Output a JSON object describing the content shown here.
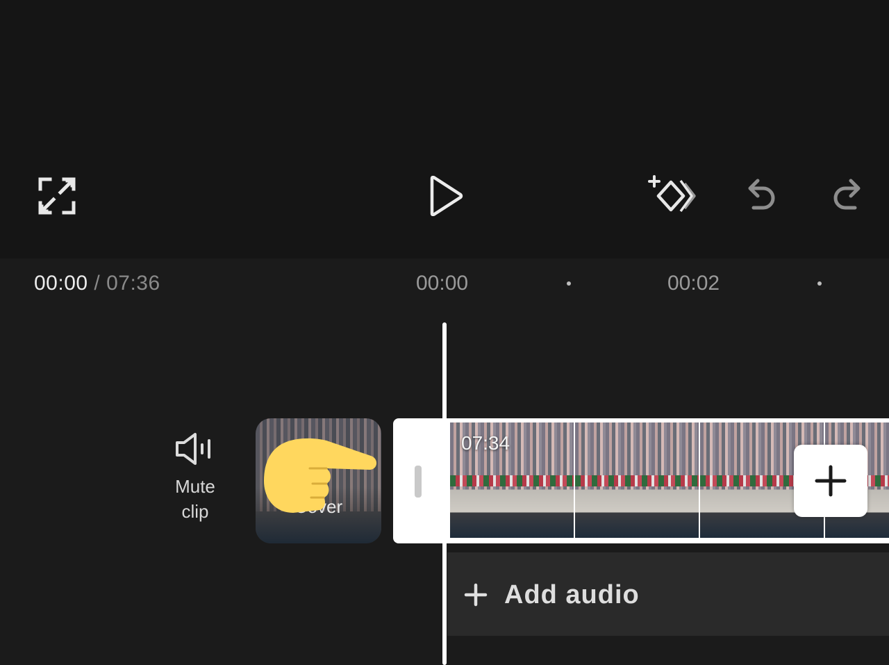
{
  "toolbar": {
    "fullscreen_icon": "fullscreen-icon",
    "play_icon": "play-icon",
    "keyframe_icon": "keyframe-icon",
    "undo_icon": "undo-icon",
    "redo_icon": "redo-icon"
  },
  "timeline": {
    "current_time": "00:00",
    "separator": " / ",
    "total_duration": "07:36",
    "ruler_labels": [
      "00:00",
      "00:02"
    ]
  },
  "track": {
    "mute_label_line1": "Mute",
    "mute_label_line2": "clip",
    "cover_label": "Cover",
    "clip_duration": "07:34",
    "add_clip_icon": "plus-icon",
    "add_audio_label": "Add audio"
  },
  "colors": {
    "background": "#181818",
    "preview_background": "#151515",
    "audio_row": "#2a2a2a",
    "playhead": "#ffffff",
    "pointer_emoji": "#FFD75E"
  }
}
